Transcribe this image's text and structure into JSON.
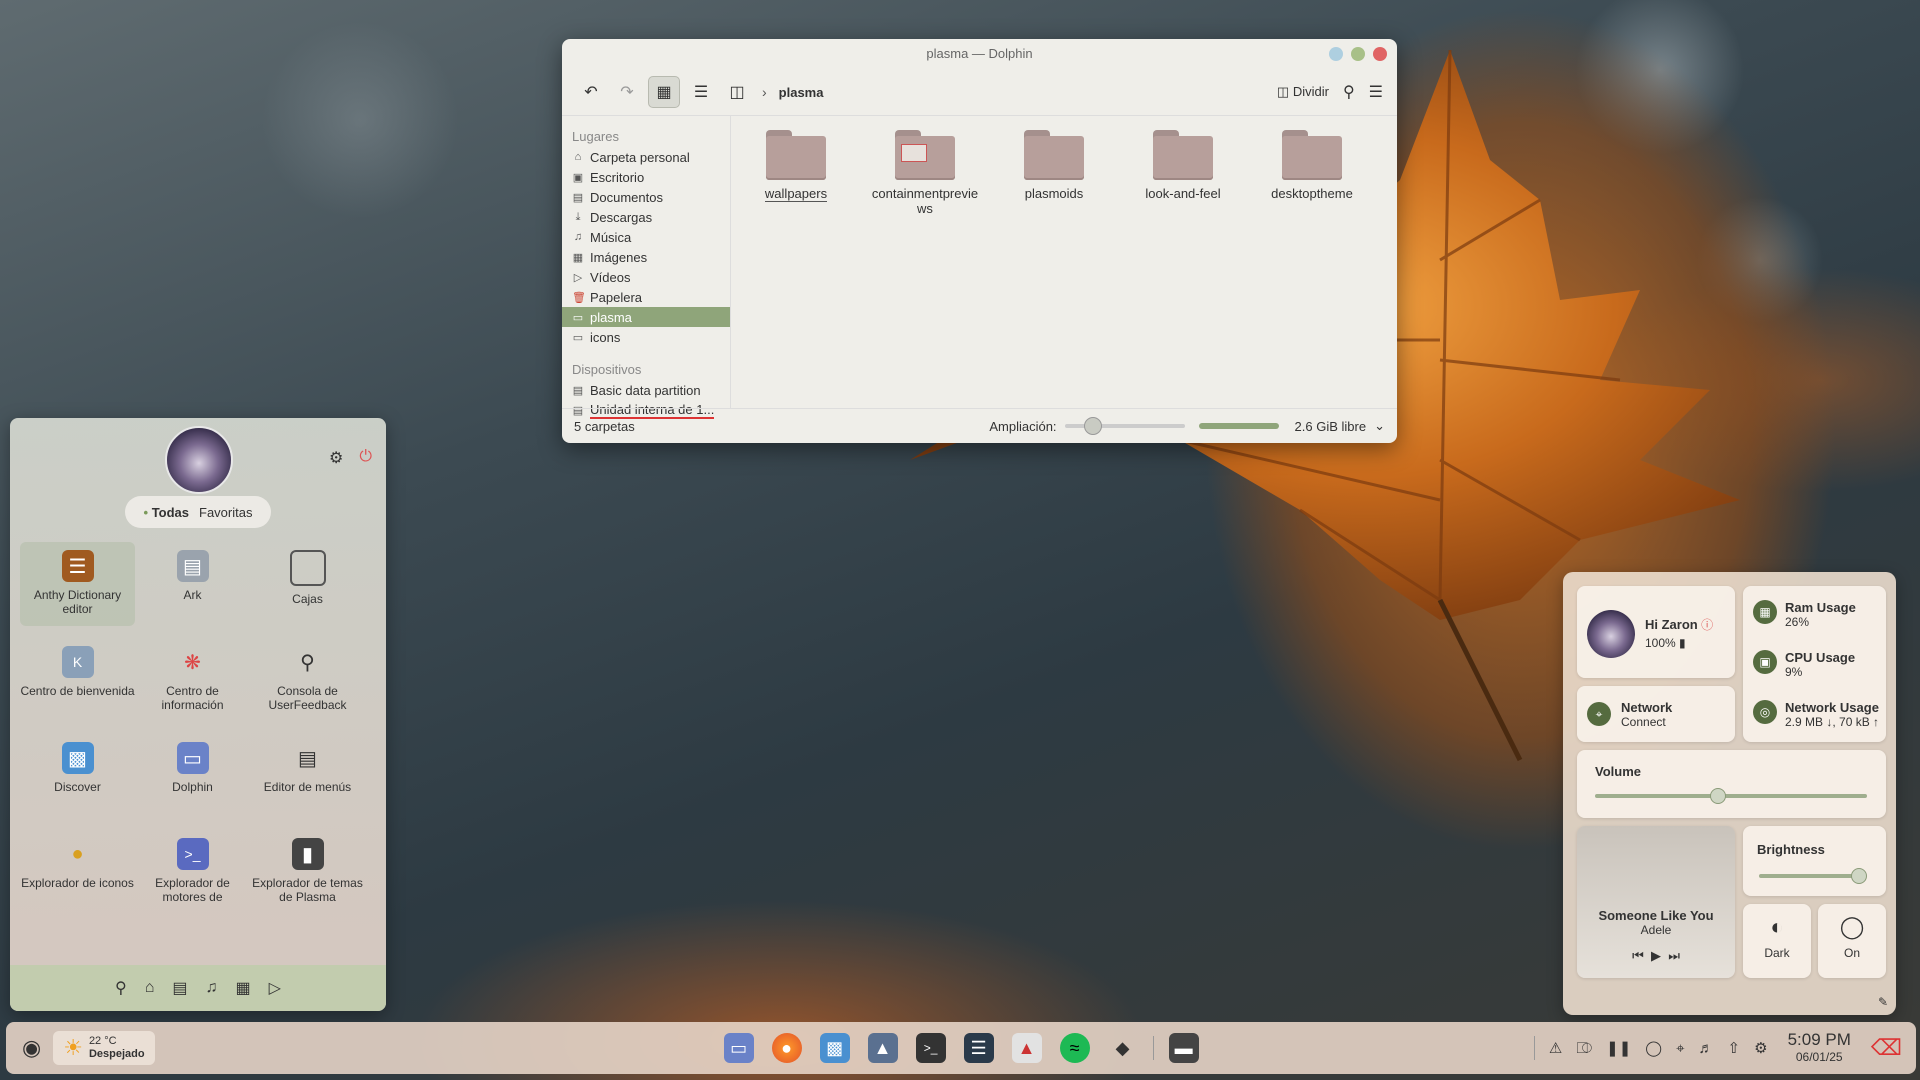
{
  "dolphin": {
    "title": "plasma — Dolphin",
    "breadcrumb": "plasma",
    "split_label": "Dividir",
    "places_header": "Lugares",
    "places": [
      "Carpeta personal",
      "Escritorio",
      "Documentos",
      "Descargas",
      "Música",
      "Imágenes",
      "Vídeos",
      "Papelera",
      "plasma",
      "icons"
    ],
    "devices_header": "Dispositivos",
    "devices": [
      "Basic data partition",
      "Unidad interna de 1..."
    ],
    "files": [
      "wallpapers",
      "containmentpreviews",
      "plasmoids",
      "look-and-feel",
      "desktoptheme"
    ],
    "status_count": "5 carpetas",
    "zoom_label": "Ampliación:",
    "free_space": "2.6 GiB libre",
    "zoom_level": 0.22,
    "used_space_fraction": 0.95
  },
  "launcher": {
    "tab_all": "Todas",
    "tab_fav": "Favoritas",
    "apps": [
      "Anthy Dictionary editor",
      "Ark",
      "Cajas",
      "Centro de bienvenida",
      "Centro de información",
      "Consola de UserFeedback",
      "Discover",
      "Dolphin",
      "Editor de menús",
      "Explorador de iconos",
      "Explorador de motores de",
      "Explorador de temas de Plasma"
    ]
  },
  "panel": {
    "greeting": "Hi Zaron",
    "battery": "100%",
    "ram_label": "Ram Usage",
    "ram_value": "26%",
    "cpu_label": "CPU Usage",
    "cpu_value": "9%",
    "net_label": "Network Usage",
    "net_value": "2.9 MB ↓, 70 kB ↑",
    "network_title": "Network",
    "network_state": "Connect",
    "volume_label": "Volume",
    "volume_level": 0.45,
    "brightness_label": "Brightness",
    "brightness_level": 0.95,
    "song": "Someone Like You",
    "artist": "Adele",
    "dark_label": "Dark",
    "light_label": "On"
  },
  "taskbar": {
    "temp": "22 °C",
    "weather": "Despejado",
    "time": "5:09 PM",
    "date": "06/01/25"
  },
  "colors": {
    "accent": "#8fa57a",
    "folder": "#b79f9b"
  }
}
